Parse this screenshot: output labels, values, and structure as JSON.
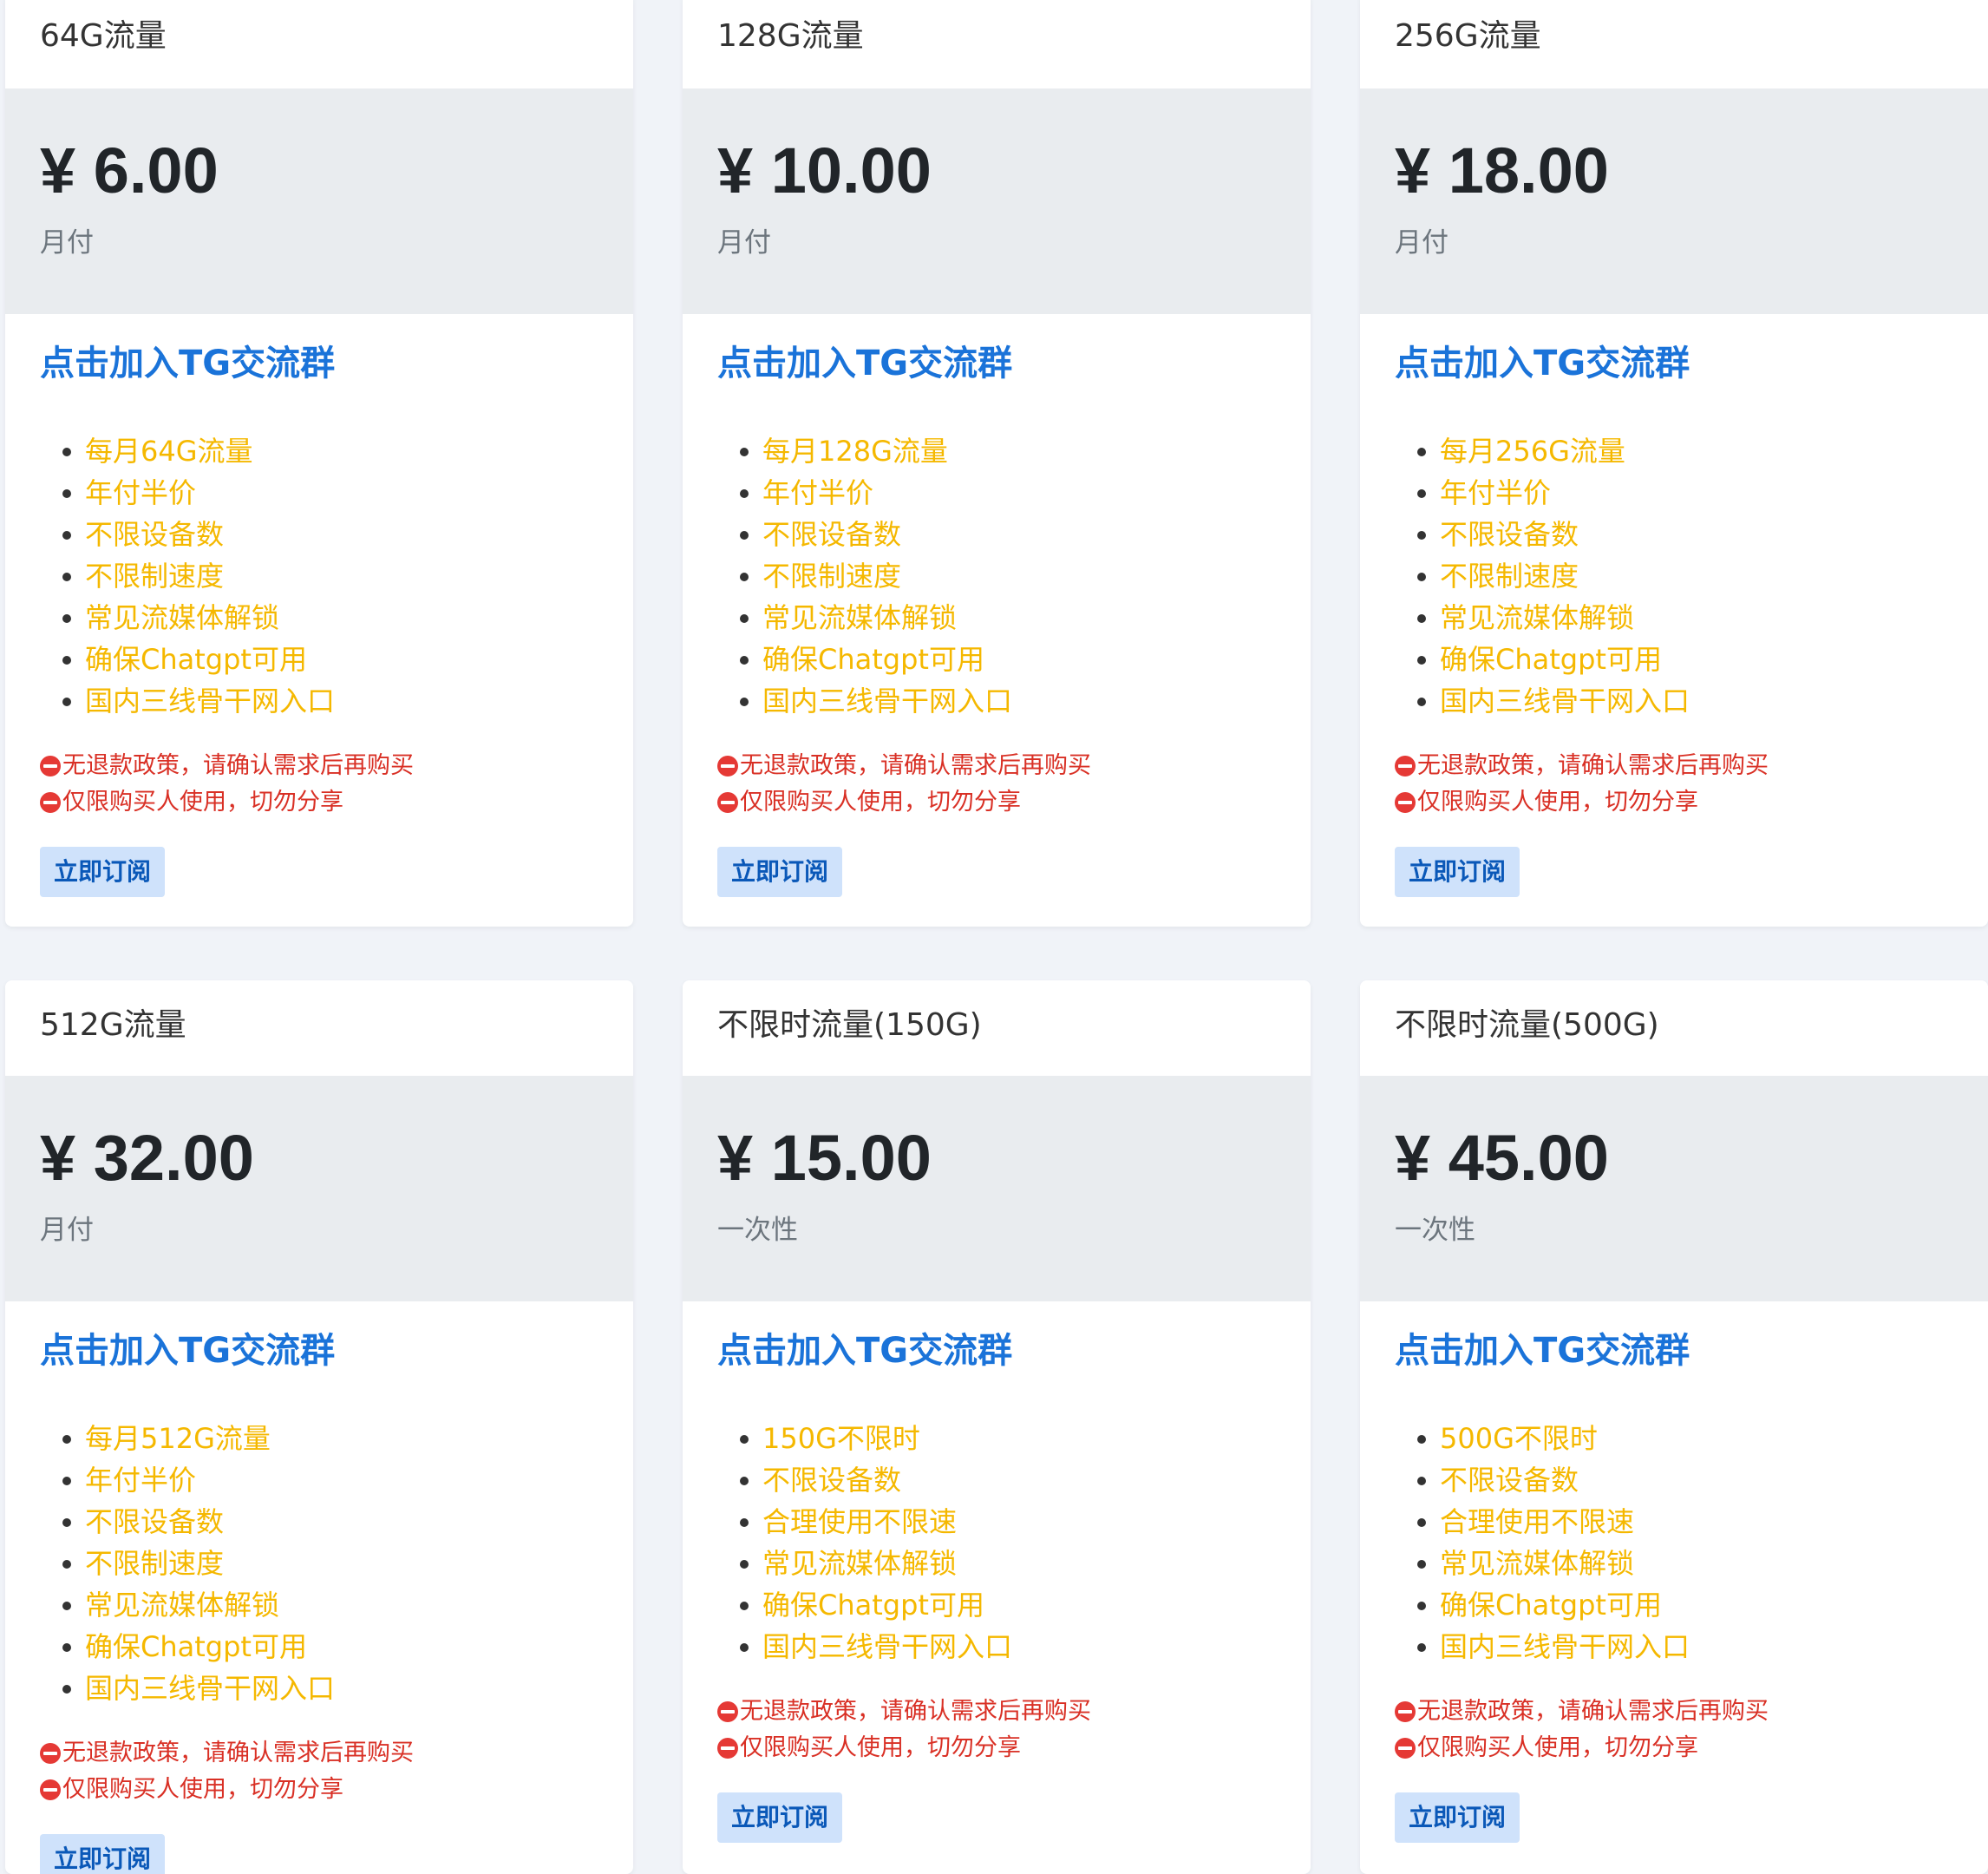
{
  "tg_link_label": "点击加入TG交流群",
  "notices": [
    "无退款政策，请确认需求后再购买",
    "仅限购买人使用，切勿分享"
  ],
  "subscribe_label": "立即订阅",
  "plans": [
    {
      "name": "64G流量",
      "price": "¥ 6.00",
      "period": "月付",
      "features": [
        "每月64G流量",
        "年付半价",
        "不限设备数",
        "不限制速度",
        "常见流媒体解锁",
        "确保Chatgpt可用",
        "国内三线骨干网入口"
      ]
    },
    {
      "name": "128G流量",
      "price": "¥ 10.00",
      "period": "月付",
      "features": [
        "每月128G流量",
        "年付半价",
        "不限设备数",
        "不限制速度",
        "常见流媒体解锁",
        "确保Chatgpt可用",
        "国内三线骨干网入口"
      ]
    },
    {
      "name": "256G流量",
      "price": "¥ 18.00",
      "period": "月付",
      "features": [
        "每月256G流量",
        "年付半价",
        "不限设备数",
        "不限制速度",
        "常见流媒体解锁",
        "确保Chatgpt可用",
        "国内三线骨干网入口"
      ]
    },
    {
      "name": "512G流量",
      "price": "¥ 32.00",
      "period": "月付",
      "features": [
        "每月512G流量",
        "年付半价",
        "不限设备数",
        "不限制速度",
        "常见流媒体解锁",
        "确保Chatgpt可用",
        "国内三线骨干网入口"
      ]
    },
    {
      "name": "不限时流量(150G)",
      "price": "¥ 15.00",
      "period": "一次性",
      "features": [
        "150G不限时",
        "不限设备数",
        "合理使用不限速",
        "常见流媒体解锁",
        "确保Chatgpt可用",
        "国内三线骨干网入口"
      ]
    },
    {
      "name": "不限时流量(500G)",
      "price": "¥ 45.00",
      "period": "一次性",
      "features": [
        "500G不限时",
        "不限设备数",
        "合理使用不限速",
        "常见流媒体解锁",
        "确保Chatgpt可用",
        "国内三线骨干网入口"
      ]
    }
  ],
  "colors": {
    "page_background": "#f0f3f8",
    "price_band": "#e9ecef",
    "link_blue": "#1a73d9",
    "feature_yellow": "#f5b800",
    "notice_red": "#d93025",
    "button_background": "#cfe2fb",
    "button_text": "#0a58b8"
  },
  "icons": {
    "notice_icon": "no-entry-icon",
    "bullet_icon": "bullet-dot"
  }
}
